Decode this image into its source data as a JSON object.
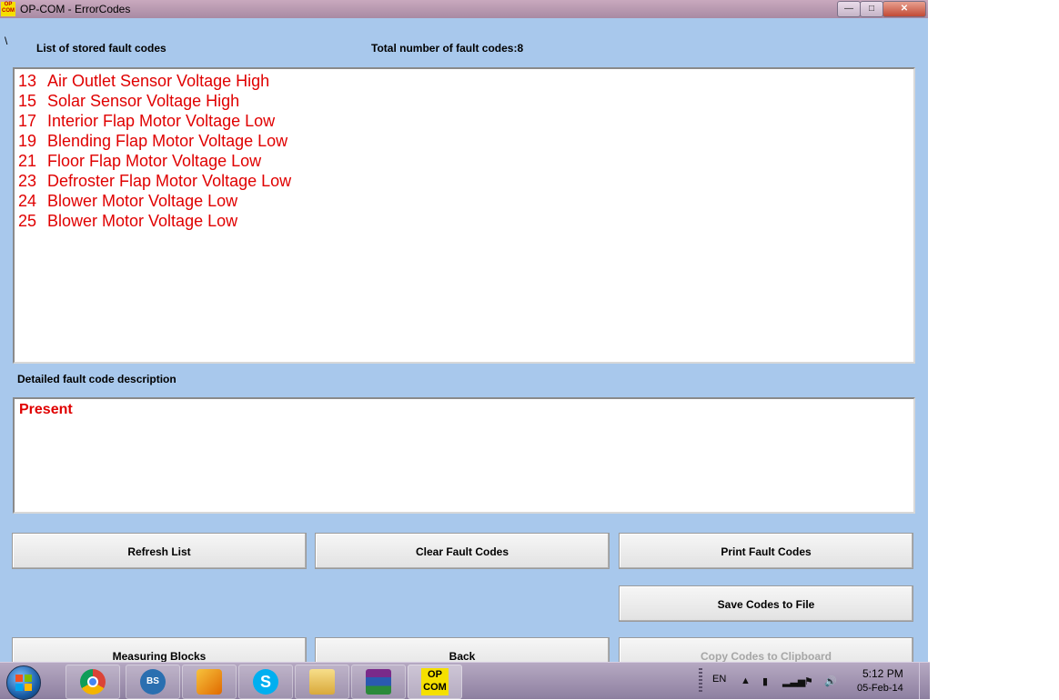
{
  "window": {
    "title": "OP-COM - ErrorCodes",
    "icon_text": "OP COM",
    "minimize_glyph": "—",
    "maximize_glyph": "□",
    "close_glyph": "✕"
  },
  "stray_char": "\\",
  "labels": {
    "list_title": "List of stored fault codes",
    "total_count": "Total number of fault codes:8",
    "detail_title": "Detailed fault code description"
  },
  "faults": [
    {
      "code": "13",
      "text": "Air Outlet Sensor Voltage High"
    },
    {
      "code": "15",
      "text": "Solar Sensor Voltage High"
    },
    {
      "code": "17",
      "text": "Interior Flap Motor Voltage Low"
    },
    {
      "code": "19",
      "text": "Blending Flap Motor Voltage Low"
    },
    {
      "code": "21",
      "text": "Floor Flap Motor Voltage Low"
    },
    {
      "code": "23",
      "text": "Defroster Flap Motor Voltage Low"
    },
    {
      "code": "24",
      "text": "Blower Motor Voltage Low"
    },
    {
      "code": "25",
      "text": "Blower Motor Voltage Low"
    }
  ],
  "detail": {
    "text": "Present"
  },
  "buttons": {
    "refresh": "Refresh List",
    "clear": "Clear Fault Codes",
    "print": "Print Fault Codes",
    "save": "Save Codes to File",
    "measuring": "Measuring Blocks",
    "back": "Back",
    "copy": "Copy Codes to Clipboard"
  },
  "taskbar": {
    "opcom_line1": "OP",
    "opcom_line2": "COM",
    "bs_label": "BS",
    "language": "EN",
    "time": "5:12 PM",
    "date": "05-Feb-14",
    "icons": [
      "chrome-icon",
      "bs-player-icon",
      "winamp-icon",
      "skype-icon",
      "explorer-icon",
      "winrar-icon",
      "opcom-icon"
    ]
  },
  "colors": {
    "window_bg": "#a8c8ec",
    "fault_text": "#e00000",
    "taskbar": "#9d90b0"
  }
}
